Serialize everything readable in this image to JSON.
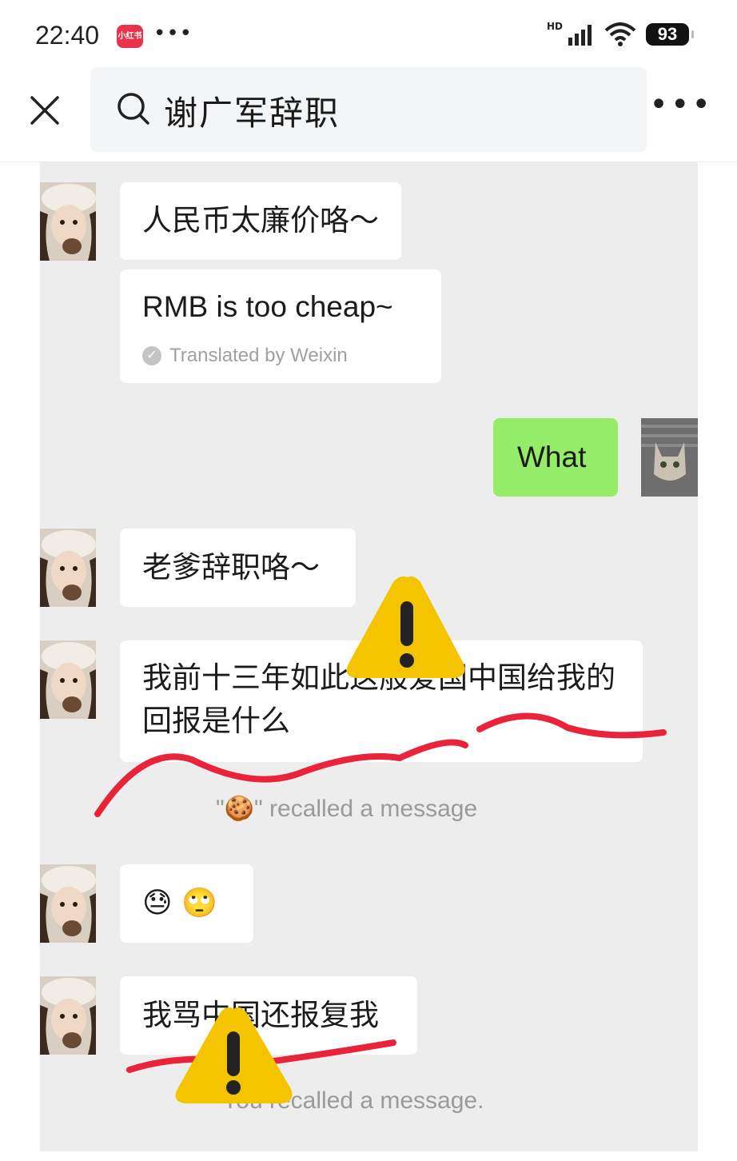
{
  "status_bar": {
    "time": "22:40",
    "app_badge": "小红书",
    "notification_dots": "•••",
    "network_label": "HD",
    "battery": "93"
  },
  "search": {
    "query": "谢广军辞职"
  },
  "chat": {
    "messages": [
      {
        "side": "left",
        "text": "人民币太廉价咯～"
      },
      {
        "side": "left",
        "text": "RMB is too cheap~",
        "note": "Translated by Weixin"
      },
      {
        "side": "right",
        "text": "What"
      },
      {
        "side": "left",
        "text": "老爹辞职咯～"
      },
      {
        "side": "left",
        "line1": "我前十三年如此这般爱国中国给我的",
        "line2": "回报是什么"
      },
      {
        "system": true,
        "quote_open": "\"",
        "quote_close": "\"",
        "emoji": "🍪",
        "text": "recalled a message"
      },
      {
        "side": "left",
        "emoji1": "😓",
        "emoji2": "🙄"
      },
      {
        "side": "left",
        "text": "我骂中国还报复我"
      },
      {
        "system": true,
        "text": "You recalled a message."
      }
    ]
  },
  "colors": {
    "chat_bg": "#ededed",
    "self_bubble": "#95ec69",
    "warning": "#f5c400",
    "scribble": "#e8233a"
  },
  "icons": [
    "close-icon",
    "search-icon",
    "more-icon",
    "wifi-icon",
    "signal-icon",
    "warning-icon"
  ]
}
